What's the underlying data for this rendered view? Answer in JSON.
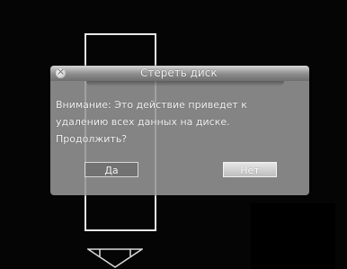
{
  "background": {
    "ghost_text_1": "",
    "ghost_text_2": ""
  },
  "dialog": {
    "title": "Стереть диск",
    "message": "Внимание: Это действие приведет  к\nудалению всех данных на диске.\nПродолжить?",
    "yes_label": "Да",
    "no_label": "Нет",
    "close_icon": "close-icon"
  },
  "colors": {
    "dialog_bg": "#969696",
    "header_text": "#f4f4f4",
    "screen_bg": "#050505"
  }
}
